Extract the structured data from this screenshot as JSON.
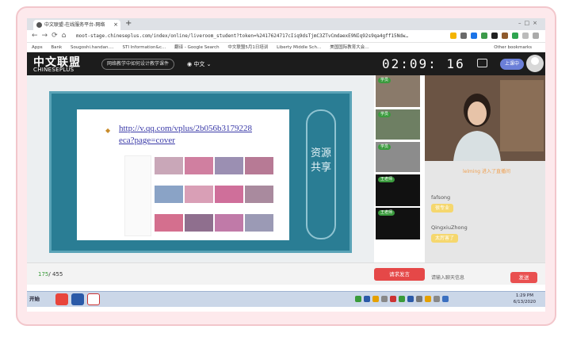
{
  "browser": {
    "tab_title": "中文联盟-在线服务平台-网络",
    "url": "moot-stage.chineseplus.com/index/online/liveroom_student?token=%2417624717cIiq9dsTjmC3ZTvCmdaexE9NIq92s9qa4gff15Ndw…",
    "bookmarks": [
      "Apps",
      "Bank",
      "Sougoshi.handan.…",
      "STI Information&c…",
      "翻译 - Google Search",
      "中文联盟5月1日培训",
      "Liberty Middle Sch…",
      "美国国际教育大会…"
    ],
    "other_bookmarks": "Other bookmarks"
  },
  "header": {
    "logo_cn": "中文联盟",
    "logo_en": "CHINESEPLUS",
    "course": "网络教学中如何设计教学课件",
    "lang": "中文",
    "timer": "02:09: 16",
    "class_status": "上课中"
  },
  "slide": {
    "link": "http://v.qq.com/vplus/2b056b3179228",
    "link2": "eca?page=cover",
    "side_text": "资源共享"
  },
  "participants": [
    "学员",
    "学员",
    "学员",
    "王老师",
    "王老师"
  ],
  "chat": {
    "system": "lelming 进入了直播间",
    "messages": [
      {
        "name": "fafsong",
        "text": "很专业"
      },
      {
        "name": "QingxiuZhong",
        "text": "太厉害了"
      }
    ]
  },
  "bottom": {
    "online": "175",
    "total": "/ 455",
    "raise_hand": "请求发言",
    "input_placeholder": "请输入聊天信息",
    "send": "发送"
  },
  "taskbar": {
    "start": "开始",
    "time": "1:29 PM",
    "date": "6/13/2020"
  },
  "colors": {
    "header": "#1c1c1c",
    "slide": "#2a7d94",
    "send": "#e95050",
    "badge": "#3b9b3e"
  }
}
